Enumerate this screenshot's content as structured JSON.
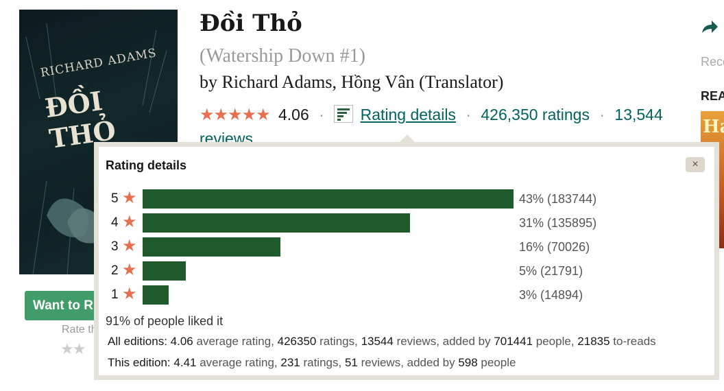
{
  "book": {
    "title": "Đồi Thỏ",
    "series": "(Watership Down #1)",
    "by": "by",
    "authors": "Richard Adams, Hồng Vân (Translator)",
    "cover_text_author": "RICHARD ADAMS",
    "cover_text_title": "ĐỒI THỎ"
  },
  "rating_row": {
    "stars": "★★★★★",
    "average": "4.06",
    "rating_details_link": "Rating details",
    "ratings_count": "426,350 ratings",
    "reviews_count": "13,544",
    "reviews_word": "reviews",
    "sep": "·"
  },
  "sidebar": {
    "reco": "Reco",
    "rea": "REA",
    "thumb_letter": "Ha"
  },
  "actions": {
    "want_to_read": "Want to R",
    "rate_this": "Rate th",
    "small_stars": "★★"
  },
  "popup": {
    "title": "Rating details",
    "close": "×",
    "rows": [
      {
        "stars": "5",
        "fraction": 0.43,
        "label": "43% (183744)"
      },
      {
        "stars": "4",
        "fraction": 0.31,
        "label": "31% (135895)"
      },
      {
        "stars": "3",
        "fraction": 0.16,
        "label": "16% (70026)"
      },
      {
        "stars": "2",
        "fraction": 0.05,
        "label": "5% (21791)"
      },
      {
        "stars": "1",
        "fraction": 0.03,
        "label": "3% (14894)"
      }
    ],
    "liked_pct": "91%",
    "liked_text": " of people liked it",
    "all_editions": {
      "label": "All editions:",
      "avg": "4.06",
      "avg_text": " average rating, ",
      "ratings": "426350",
      "ratings_text": " ratings, ",
      "reviews": "13544",
      "reviews_text": " reviews, added by ",
      "people": "701441",
      "people_text": " people, ",
      "toreads": "21835",
      "toreads_text": " to-reads"
    },
    "this_edition": {
      "label": "This edition:",
      "avg": "4.41",
      "avg_text": " average rating, ",
      "ratings": "231",
      "ratings_text": " ratings, ",
      "reviews": "51",
      "reviews_text": " reviews, added by ",
      "people": "598",
      "people_text": " people"
    }
  },
  "colors": {
    "star": "#e76f51",
    "bar": "#1f5a2d",
    "link": "#00635d",
    "want_button": "#409d69"
  }
}
